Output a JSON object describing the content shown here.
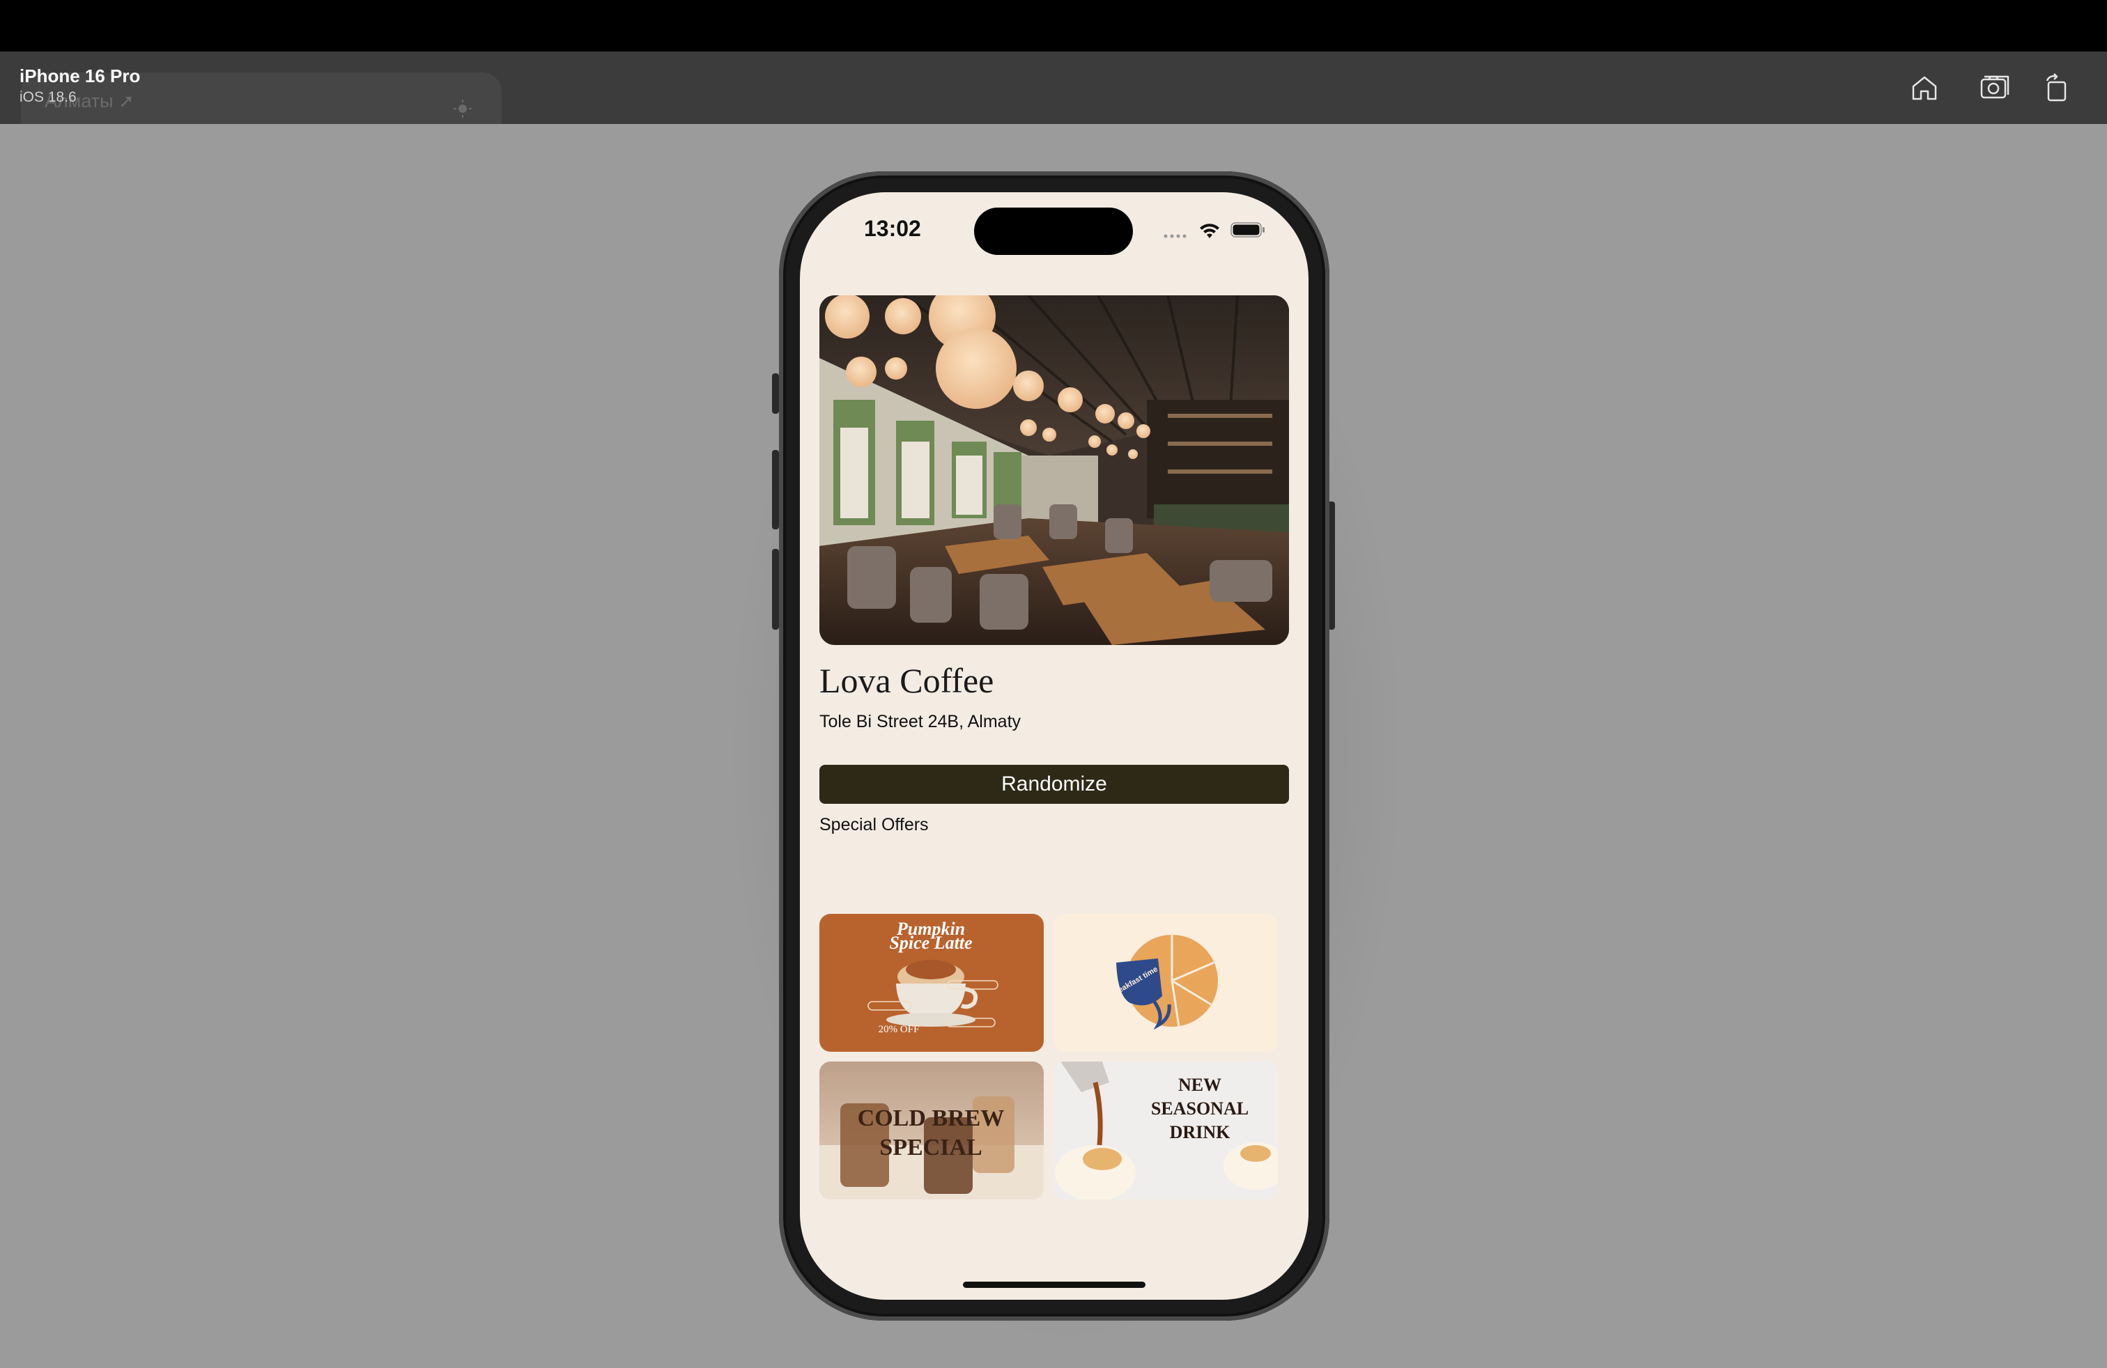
{
  "simulator": {
    "device_name": "iPhone 16 Pro",
    "os_version": "iOS 18.6",
    "ghost_widget_text": "Алматы ➚",
    "buttons": [
      "home-icon",
      "screenshot-icon",
      "rotate-icon"
    ]
  },
  "status_bar": {
    "time": "13:02"
  },
  "app": {
    "cafe_name": "Lova Coffee",
    "address": "Tole Bi Street 24B, Almaty",
    "randomize_label": "Randomize",
    "offers_title": "Special Offers",
    "offers": [
      {
        "title_line1": "Pumpkin",
        "title_line2": "Spice Latte",
        "discount": "20% OFF",
        "bg": "#b8632e"
      },
      {
        "text": "breakfast time",
        "bg": "#fbeedd"
      },
      {
        "line1": "COLD BREW",
        "line2": "SPECIAL"
      },
      {
        "line1": "NEW",
        "line2": "SEASONAL",
        "line3": "DRINK"
      }
    ]
  },
  "colors": {
    "screen_bg": "#f4ece3",
    "button_bg": "#2e2917",
    "toolbar_bg": "#3c3c3c",
    "desktop_bg": "#9b9b9b"
  }
}
